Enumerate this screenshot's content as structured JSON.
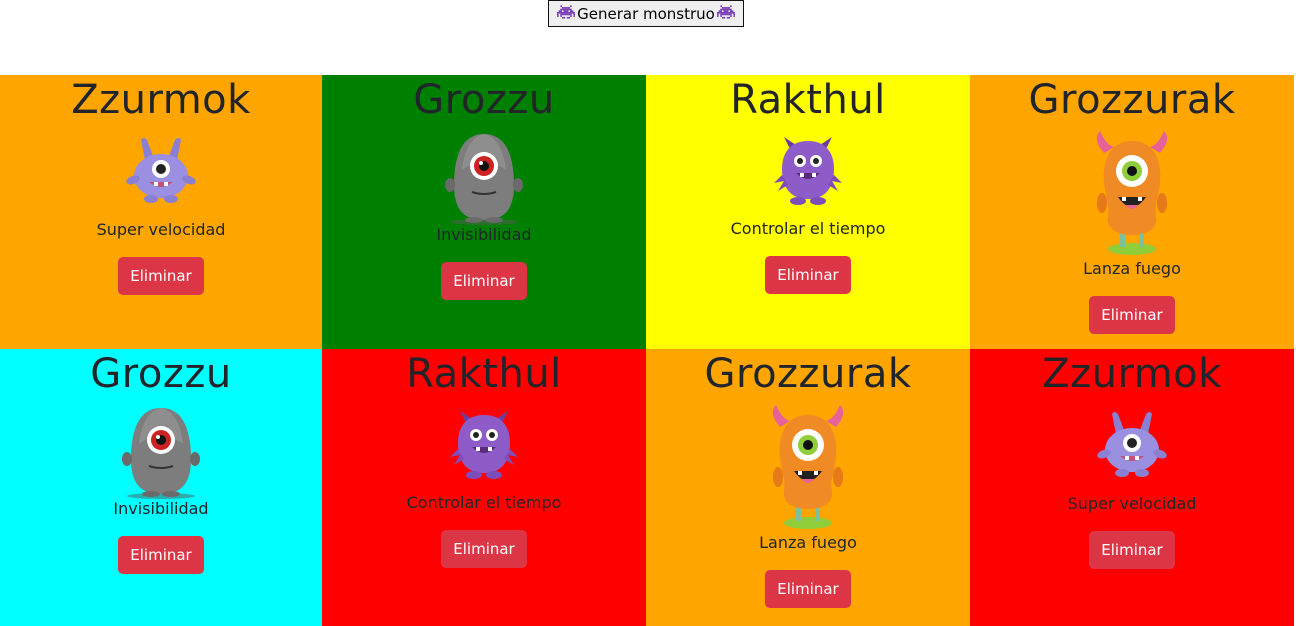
{
  "header": {
    "generate_label": "Generar monstruo",
    "icon": "alien-monster-icon"
  },
  "monsters": [
    {
      "name": "Zzurmok",
      "power": "Super velocidad",
      "bg": "#ffa500",
      "type": "blue-monster",
      "delete_label": "Eliminar"
    },
    {
      "name": "Grozzu",
      "power": "Invisibilidad",
      "bg": "#008000",
      "type": "gray-monster",
      "delete_label": "Eliminar"
    },
    {
      "name": "Rakthul",
      "power": "Controlar el tiempo",
      "bg": "#ffff00",
      "type": "purple-monster",
      "delete_label": "Eliminar"
    },
    {
      "name": "Grozzurak",
      "power": "Lanza fuego",
      "bg": "#ffa500",
      "type": "orange-monster",
      "delete_label": "Eliminar"
    },
    {
      "name": "Grozzu",
      "power": "Invisibilidad",
      "bg": "#00ffff",
      "type": "gray-monster",
      "delete_label": "Eliminar"
    },
    {
      "name": "Rakthul",
      "power": "Controlar el tiempo",
      "bg": "#ff0000",
      "type": "purple-monster",
      "delete_label": "Eliminar"
    },
    {
      "name": "Grozzurak",
      "power": "Lanza fuego",
      "bg": "#ffa500",
      "type": "orange-monster",
      "delete_label": "Eliminar"
    },
    {
      "name": "Zzurmok",
      "power": "Super velocidad",
      "bg": "#ff0000",
      "type": "blue-monster",
      "delete_label": "Eliminar"
    }
  ]
}
